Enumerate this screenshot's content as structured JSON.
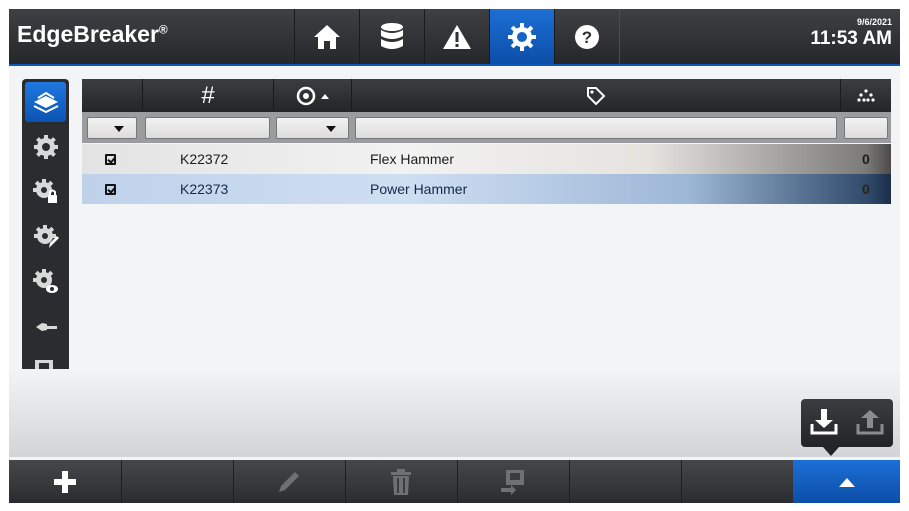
{
  "app": {
    "brand": "EdgeBreaker",
    "brand_mark": "®"
  },
  "header": {
    "nav": [
      {
        "icon": "home-icon"
      },
      {
        "icon": "database-icon"
      },
      {
        "icon": "warning-icon"
      },
      {
        "icon": "gear-icon",
        "active": true
      },
      {
        "icon": "help-icon"
      }
    ],
    "date": "9/6/2021",
    "time": "11:53 AM",
    "accent": "#0b58b8"
  },
  "sidebar": {
    "items": [
      {
        "icon": "tools-stack-icon",
        "active": true
      },
      {
        "icon": "gear-icon"
      },
      {
        "icon": "gear-lock-icon"
      },
      {
        "icon": "gear-edit-icon"
      },
      {
        "icon": "gear-view-icon"
      },
      {
        "icon": "hammer-icon"
      },
      {
        "icon": "machine-settings-icon"
      }
    ]
  },
  "table": {
    "headers": [
      {
        "key": "select",
        "label": ""
      },
      {
        "key": "number",
        "label": "#"
      },
      {
        "key": "type",
        "label": "",
        "icon": "target-icon",
        "sort": "ascending"
      },
      {
        "key": "name",
        "label": "",
        "icon": "tag-icon"
      },
      {
        "key": "count",
        "label": "",
        "icon": "quantity-icon"
      }
    ],
    "filters": {
      "select": "",
      "number": "",
      "type": "",
      "name": "",
      "count": ""
    },
    "rows": [
      {
        "checked": true,
        "number": "K22372",
        "type": "",
        "name": "Flex Hammer",
        "count": "0",
        "selected": false
      },
      {
        "checked": true,
        "number": "K22373",
        "type": "",
        "name": "Power Hammer",
        "count": "0",
        "selected": true
      }
    ]
  },
  "io": {
    "import_icon": "import-icon",
    "export_icon": "export-icon"
  },
  "toolbar": {
    "buttons": [
      {
        "icon": "add-icon",
        "enabled": true
      },
      {
        "icon": "",
        "enabled": false
      },
      {
        "icon": "edit-icon",
        "enabled": false
      },
      {
        "icon": "delete-icon",
        "enabled": false
      },
      {
        "icon": "assign-machine-icon",
        "enabled": false
      },
      {
        "icon": "",
        "enabled": false
      },
      {
        "icon": "",
        "enabled": false
      },
      {
        "icon": "expand-up-icon",
        "enabled": true
      }
    ]
  }
}
